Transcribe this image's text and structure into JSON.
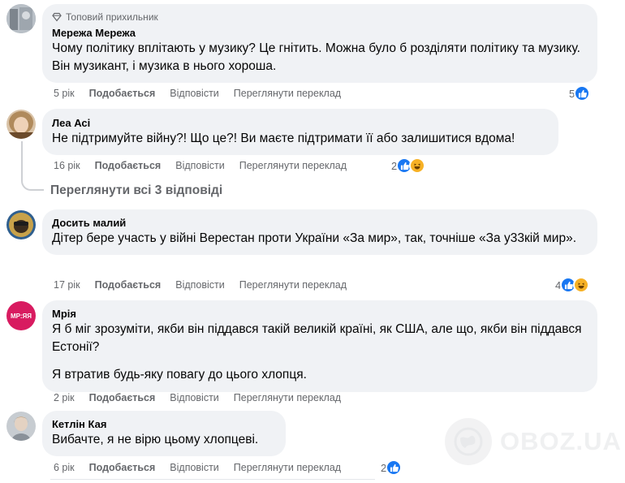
{
  "comments": [
    {
      "badge": "Топовий прихильник",
      "author": "Мережа Мережа",
      "text": "Чому політику вплітають у музику? Це гнітить. Можна було б розділяти політику та музику. Він музикант, і музика в нього хороша.",
      "time": "5 рік",
      "like": "Подобається",
      "reply": "Відповісти",
      "translate": "Переглянути переклад",
      "reactions_count": "5",
      "reactions": [
        "like"
      ]
    },
    {
      "author": "Леа Асі",
      "text": "Не підтримуйте війну?! Що це?! Ви маєте підтримати її або залишитися вдома!",
      "time": "16 рік",
      "like": "Подобається",
      "reply": "Відповісти",
      "translate": "Переглянути переклад",
      "reactions_count": "2",
      "reactions": [
        "like",
        "haha"
      ]
    },
    {
      "author": "Досить малий",
      "text": "Дітер бере участь у війні Верестан проти України «За мир», так, точніше «За у33кій мир».",
      "time": "17 рік",
      "like": "Подобається",
      "reply": "Відповісти",
      "translate": "Переглянути переклад",
      "reactions_count": "4",
      "reactions": [
        "like",
        "haha"
      ]
    },
    {
      "author": "Мрія",
      "text": "Я б міг зрозуміти, якби він піддався такій великій країні, як США, але що, якби він піддався Естонії?",
      "text2": "Я втратив будь-яку повагу до цього хлопця.",
      "time": "2 рік",
      "like": "Подобається",
      "reply": "Відповісти",
      "translate": "Переглянути переклад"
    },
    {
      "author": "Кетлін Кая",
      "text": "Вибачте, я не вірю цьому хлопцеві.",
      "time": "6 рік",
      "like": "Подобається",
      "reply": "Відповісти",
      "translate": "Переглянути переклад",
      "reactions_count": "2",
      "reactions": [
        "like"
      ]
    }
  ],
  "view_replies": "Переглянути всі 3 відповіді",
  "avatar_logo_text": "МР:ЯЯ",
  "watermark": "OBOZ.UA",
  "colors": {
    "bubble": "#f0f2f5",
    "secondary_text": "#65676b",
    "like_blue": "#1877f2",
    "haha_yellow": "#f7b125",
    "mriya_avatar": "#d81b60"
  }
}
